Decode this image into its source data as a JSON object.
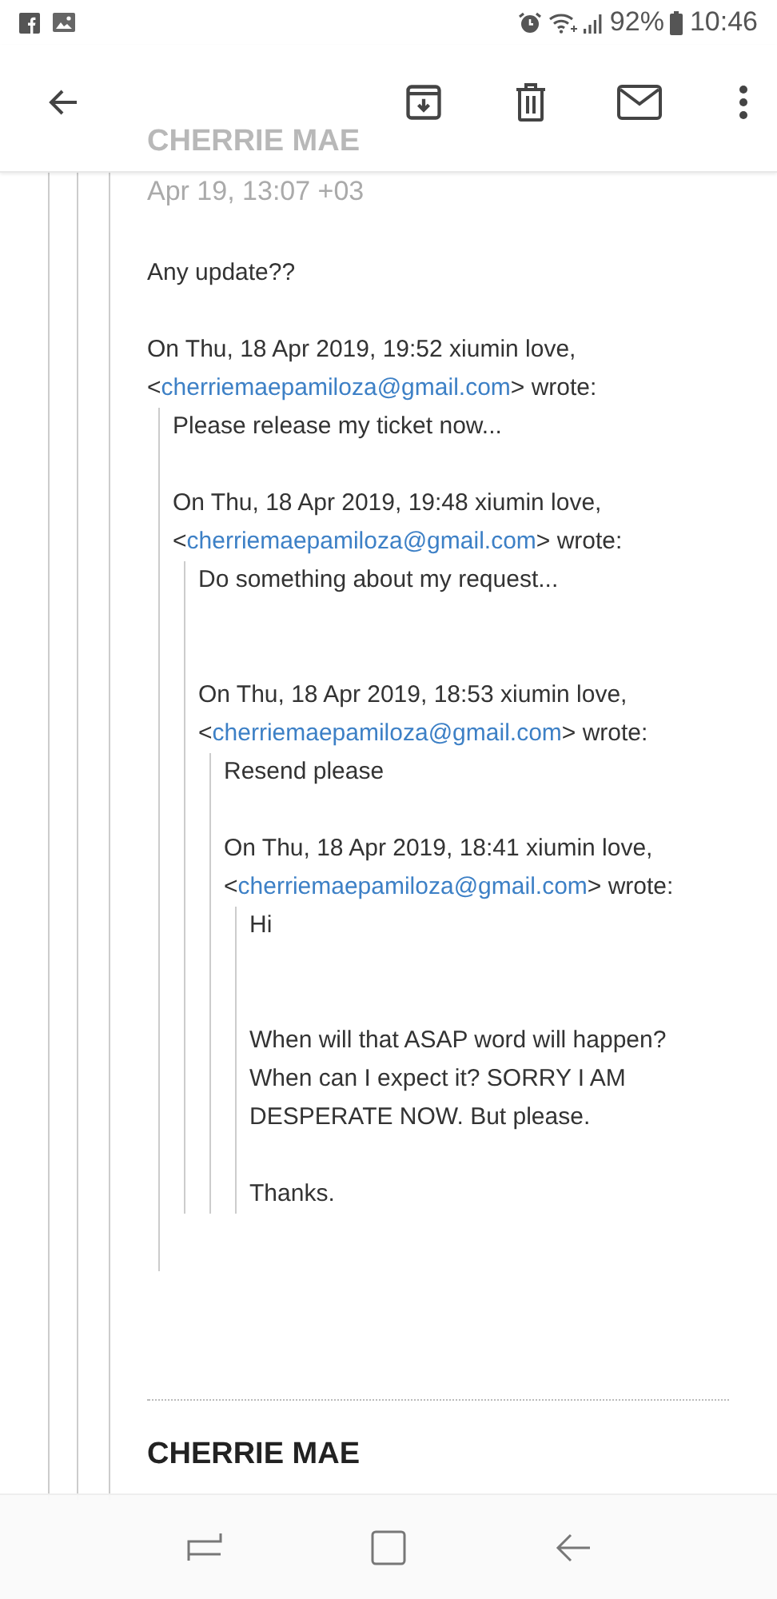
{
  "status_bar": {
    "battery": "92%",
    "time": "10:46"
  },
  "messages": [
    {
      "sender": "CHERRIE MAE",
      "date": "Apr 19, 13:07 +03",
      "body": {
        "paragraphs": [
          "Any update??"
        ],
        "attribution": {
          "text": "On Thu, 18 Apr 2019, 19:52 xiumin love,",
          "before": "<",
          "email": "cherriemaepamiloza@gmail.com",
          "after": "> wrote:"
        },
        "quote": {
          "paragraphs": [
            "Please release my ticket now..."
          ],
          "attribution": {
            "text": "On Thu, 18 Apr 2019, 19:48 xiumin love,",
            "before": "<",
            "email": "cherriemaepamiloza@gmail.com",
            "after": "> wrote:"
          },
          "quote": {
            "paragraphs": [
              "Do something about my request..."
            ],
            "attribution": {
              "text": "On Thu, 18 Apr 2019, 18:53 xiumin love,",
              "before": "<",
              "email": "cherriemaepamiloza@gmail.com",
              "after": "> wrote:"
            },
            "quote": {
              "paragraphs": [
                "Resend please"
              ],
              "attribution": {
                "text": "On Thu, 18 Apr 2019, 18:41 xiumin love,",
                "before": "<",
                "email": "cherriemaepamiloza@gmail.com",
                "after": "> wrote:"
              },
              "quote": {
                "paragraphs": [
                  "Hi",
                  "When will that ASAP word  will happen? When can I expect it? SORRY I AM DESPERATE NOW. But please.",
                  "Thanks."
                ]
              }
            }
          }
        }
      }
    },
    {
      "sender": "CHERRIE MAE"
    }
  ]
}
